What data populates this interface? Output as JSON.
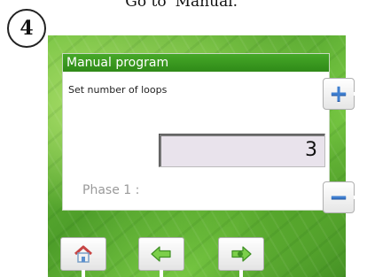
{
  "caption": "Go to 'Manual.'",
  "step": {
    "number": "4"
  },
  "panel": {
    "title": "Manual program",
    "subtitle": "Set number of loops",
    "value": "3",
    "phase_label": "Phase 1 :"
  },
  "side_buttons": {
    "plus_glyph": "+",
    "minus_glyph": "−"
  },
  "bottom_buttons": [
    {
      "name": "home",
      "icon": "home-icon"
    },
    {
      "name": "back",
      "icon": "arrow-left-icon"
    },
    {
      "name": "ok",
      "icon": "ok-arrow-icon"
    }
  ],
  "colors": {
    "title_bar": "#3a9a20",
    "background": "#5fae33",
    "accent_blue": "#3f7fd0"
  }
}
